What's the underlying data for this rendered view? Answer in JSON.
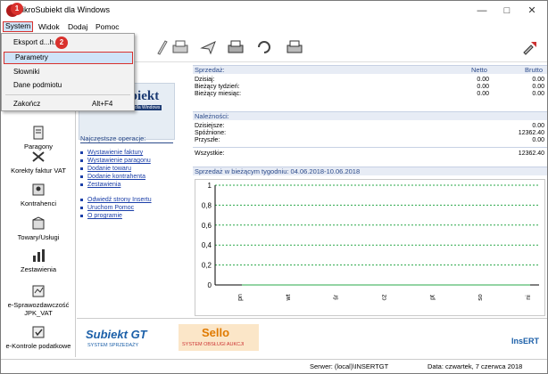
{
  "window": {
    "title": "InsERT Subiekt dla Windows",
    "title_visible": "ikroSubiekt dla Windows"
  },
  "menubar": {
    "items": [
      "System",
      "Widok",
      "Dodaj",
      "Pomoc"
    ]
  },
  "dropdown": {
    "items": [
      {
        "label": "Eksport d...h...",
        "shortcut": ""
      },
      {
        "label": "Parametry",
        "shortcut": ""
      },
      {
        "label": "Słowniki",
        "shortcut": ""
      },
      {
        "label": "Dane podmiotu",
        "shortcut": ""
      },
      {
        "label": "Zakończ",
        "shortcut": "Alt+F4"
      }
    ]
  },
  "markers": [
    "1",
    "2"
  ],
  "sidebar": {
    "items": [
      {
        "label": "Paragony"
      },
      {
        "label": "Korekty faktur VAT"
      },
      {
        "label": "Kontrahenci"
      },
      {
        "label": "Towary/Usługi"
      },
      {
        "label": "Zestawienia"
      },
      {
        "label": "e-Sprawozdawczość JPK_VAT"
      },
      {
        "label": "e-Kontrole podatkowe"
      }
    ]
  },
  "logo": {
    "text": "Subiekt",
    "sub": "dla Windows"
  },
  "sales": {
    "title": "Sprzedaż:",
    "col_netto": "Netto",
    "col_brutto": "Brutto",
    "rows": [
      {
        "label": "Dzisiaj:",
        "netto": "0.00",
        "brutto": "0.00"
      },
      {
        "label": "Bieżący tydzień:",
        "netto": "0.00",
        "brutto": "0.00"
      },
      {
        "label": "Bieżący miesiąc:",
        "netto": "0.00",
        "brutto": "0.00"
      }
    ]
  },
  "receivables": {
    "title": "Należności:",
    "rows": [
      {
        "label": "Dzisiejsze:",
        "value": "0.00"
      },
      {
        "label": "Spóźnione:",
        "value": "12362.40"
      },
      {
        "label": "Przyszłe:",
        "value": "0.00"
      }
    ],
    "total_label": "Wszystkie:",
    "total_value": "12362.40"
  },
  "operations": {
    "title": "Najczęstsze operacje:",
    "items": [
      "Wystawienie faktury",
      "Wystawienie paragonu",
      "Dodanie towaru",
      "Dodanie kontrahenta",
      "Zestawienia",
      "Odwiedź strony Insertu",
      "Uruchom Pomoc",
      "O programie"
    ]
  },
  "chart_data": {
    "type": "line",
    "title": "Sprzedaż w bieżącym tygodniu: 04.06.2018-10.06.2018",
    "categories": [
      "pn",
      "wt",
      "śr",
      "cz",
      "pt",
      "so",
      "ni"
    ],
    "series": [
      {
        "values": [
          0,
          0,
          0,
          0,
          0,
          0,
          0
        ]
      }
    ],
    "ylim": [
      0,
      1
    ],
    "yticks": [
      "1",
      "0,8",
      "0,6",
      "0,4",
      "0,2",
      "0"
    ],
    "grid": true,
    "grid_color": "#2aa84a"
  },
  "bottom": {
    "subiekt_logo": "Subiekt GT",
    "subiekt_sub": "SYSTEM SPRZEDAŻY",
    "sello_logo": "Sello",
    "sello_sub": "SYSTEM OBSŁUGI AUKCJI",
    "insert_logo": "InsERT"
  },
  "status": {
    "server": "Serwer: (local)\\INSERTGT",
    "date": "Data: czwartek, 7 czerwca 2018"
  },
  "colors": {
    "accent": "#2b4a8a",
    "link": "#1a3ea8",
    "highlight": "#d9312d"
  }
}
